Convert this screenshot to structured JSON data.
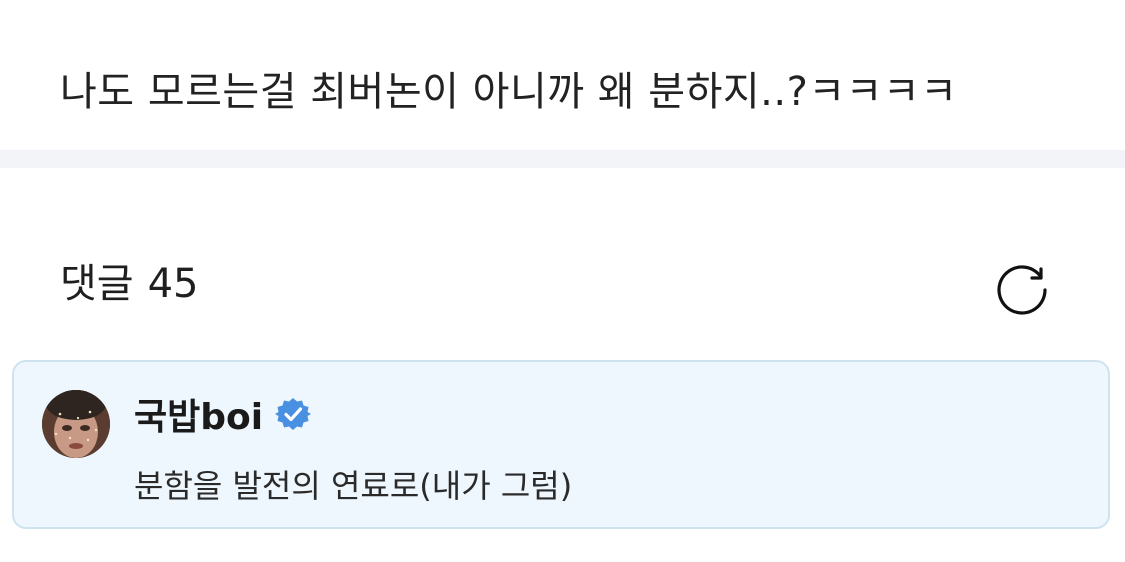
{
  "post": {
    "body": "나도 모르는걸 최버논이 아니까 왜 분하지..?ㅋㅋㅋㅋ"
  },
  "comments": {
    "label": "댓글",
    "count": "45",
    "refresh_icon": "refresh-icon"
  },
  "comment": {
    "author": "국밥boi",
    "verified_icon": "verified-badge-icon",
    "text": "분함을 발전의 연료로(내가 그럼)",
    "avatar_icon": "avatar"
  },
  "colors": {
    "card_background": "#eef7fd",
    "card_border": "#cfe3ef",
    "verified_blue": "#4a90e2",
    "divider": "#f3f4f7"
  }
}
